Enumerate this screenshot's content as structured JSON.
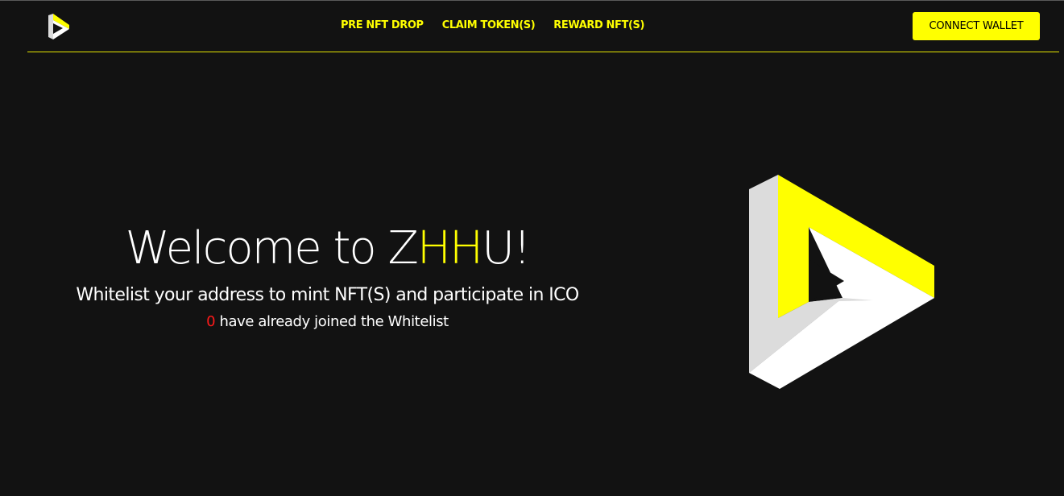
{
  "navbar": {
    "logo_icon": "play-triangle-logo-icon",
    "links": [
      "PRE NFT DROP",
      "CLAIM TOKEN(S)",
      "REWARD NFT(S)"
    ],
    "connect_label": "CONNECT WALLET"
  },
  "hero": {
    "title_prefix": "Welcome to Z",
    "title_highlight": "HH",
    "title_suffix": "U!",
    "subtitle": "Whitelist your address to mint NFT(S) and participate in ICO",
    "count": "0",
    "count_text": " have already joined the Whitelist",
    "graphic_icon": "impossible-triangle-play-icon"
  },
  "colors": {
    "background": "#121212",
    "accent": "#ffff00",
    "count": "#ff1a1a",
    "shape_light": "#dcdcdc",
    "shape_white": "#ffffff"
  }
}
